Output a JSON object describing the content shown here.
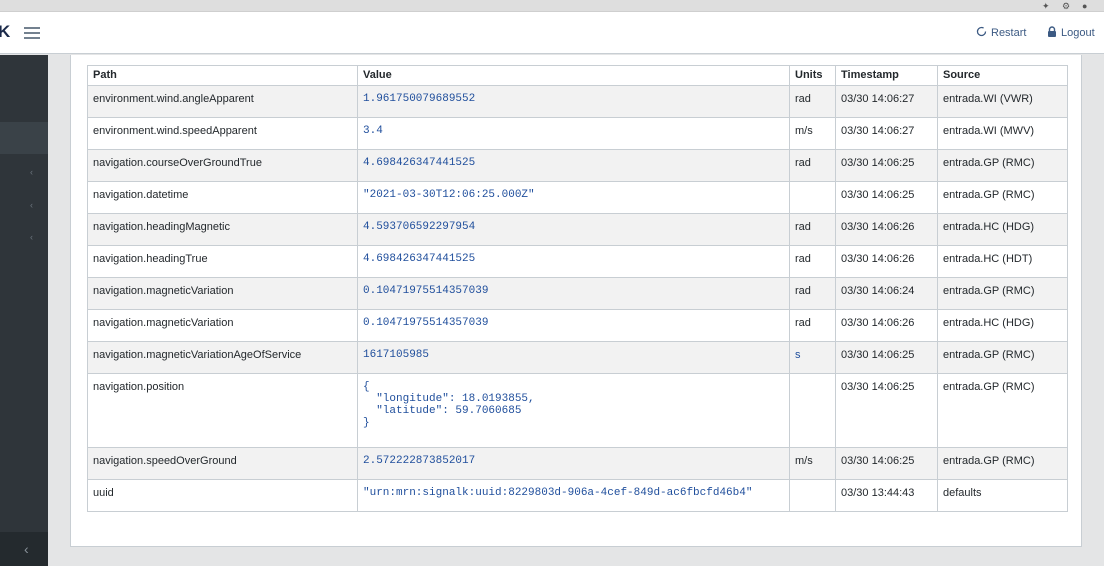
{
  "header": {
    "brand": "K",
    "restart_label": "Restart",
    "logout_label": "Logout"
  },
  "table": {
    "columns": [
      "Path",
      "Value",
      "Units",
      "Timestamp",
      "Source"
    ],
    "rows": [
      {
        "path": "environment.wind.angleApparent",
        "value": "1.961750079689552",
        "units": "rad",
        "timestamp": "03/30 14:06:27",
        "source": "entrada.WI (VWR)"
      },
      {
        "path": "environment.wind.speedApparent",
        "value": "3.4",
        "units": "m/s",
        "timestamp": "03/30 14:06:27",
        "source": "entrada.WI (MWV)"
      },
      {
        "path": "navigation.courseOverGroundTrue",
        "value": "4.698426347441525",
        "units": "rad",
        "timestamp": "03/30 14:06:25",
        "source": "entrada.GP (RMC)"
      },
      {
        "path": "navigation.datetime",
        "value": "\"2021-03-30T12:06:25.000Z\"",
        "units": "",
        "timestamp": "03/30 14:06:25",
        "source": "entrada.GP (RMC)"
      },
      {
        "path": "navigation.headingMagnetic",
        "value": "4.593706592297954",
        "units": "rad",
        "timestamp": "03/30 14:06:26",
        "source": "entrada.HC (HDG)"
      },
      {
        "path": "navigation.headingTrue",
        "value": "4.698426347441525",
        "units": "rad",
        "timestamp": "03/30 14:06:26",
        "source": "entrada.HC (HDT)"
      },
      {
        "path": "navigation.magneticVariation",
        "value": "0.10471975514357039",
        "units": "rad",
        "timestamp": "03/30 14:06:24",
        "source": "entrada.GP (RMC)"
      },
      {
        "path": "navigation.magneticVariation",
        "value": "0.10471975514357039",
        "units": "rad",
        "timestamp": "03/30 14:06:26",
        "source": "entrada.HC (HDG)"
      },
      {
        "path": "navigation.magneticVariationAgeOfService",
        "value": "1617105985",
        "units": "s",
        "timestamp": "03/30 14:06:25",
        "source": "entrada.GP (RMC)"
      },
      {
        "path": "navigation.position",
        "value": "{\n  \"longitude\": 18.0193855,\n  \"latitude\": 59.7060685\n}",
        "units": "",
        "timestamp": "03/30 14:06:25",
        "source": "entrada.GP (RMC)"
      },
      {
        "path": "navigation.speedOverGround",
        "value": "2.572222873852017",
        "units": "m/s",
        "timestamp": "03/30 14:06:25",
        "source": "entrada.GP (RMC)"
      },
      {
        "path": "uuid",
        "value": "\"urn:mrn:signalk:uuid:8229803d-906a-4cef-849d-ac6fbcfd46b4\"",
        "units": "",
        "timestamp": "03/30 13:44:43",
        "source": "defaults"
      }
    ]
  },
  "icons": {
    "restart": "circle-arrow-icon",
    "logout": "lock-icon",
    "menu": "hamburger-icon",
    "sidebar_chevron": "chevron-left-icon"
  }
}
